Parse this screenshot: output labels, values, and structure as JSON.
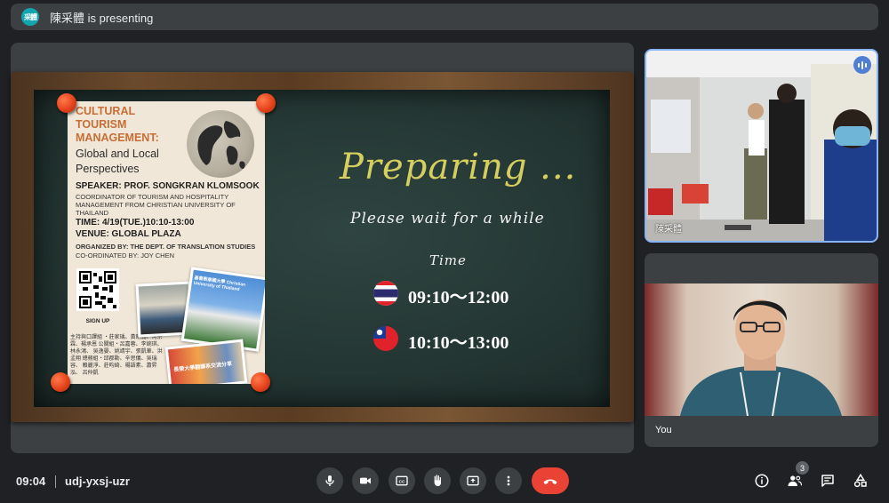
{
  "topbar": {
    "avatar_text": "采體",
    "presenting_text": "陳采體 is presenting"
  },
  "poster": {
    "title": "CULTURAL TOURISM MANAGEMENT:",
    "subtitle": "Global and Local Perspectives",
    "speaker": "SPEAKER: PROF. SONGKRAN KLOMSOOK",
    "coordinator": "COORDINATOR OF TOURISM AND HOSPITALITY MANAGEMENT FROM CHRISTIAN UNIVERSITY OF THAILAND",
    "time": "TIME: 4/19(TUE.)10:10-13:00",
    "venue": "VENUE: GLOBAL PLAZA",
    "organized": "ORGANIZED BY: THE DEPT. OF TRANSLATION STUDIES",
    "coordinated": "CO-ORDINATED BY: JOY CHEN",
    "signup": "SIGN UP",
    "names": "主持與口譯組 ‧莊家瑀、黃昕翰、何宗霖、楊承恩 公關組‧呂嘉蓉、李婉琪、林永鴻、 吳逸晏、姚靖宇、張凱華、洪孟翔 總務組‧邱郡勳、辛思儀、吳瑞容、 賴麗淨、莊昀綺、楊語素、蕭昇泓、 呂仲凱",
    "photo_banner": "基督教泰國大學 Christian University of Thailand",
    "photo_banner2": "長榮大學翻譯系交流分享"
  },
  "slide": {
    "preparing": "Preparing ...",
    "wait": "Please wait for a while",
    "time_label": "Time",
    "thai_time": "09:10～12:00",
    "taiwan_time": "10:10～13:00"
  },
  "tiles": {
    "presenter_name": "陳采體",
    "self_name": "You"
  },
  "bottom": {
    "clock": "09:04",
    "meeting_code": "udj-yxsj-uzr",
    "people_count": "3"
  },
  "colors": {
    "end_call": "#ea4335",
    "active_border": "#8ab4f8",
    "chalk_yellow": "#d4cf5f"
  }
}
